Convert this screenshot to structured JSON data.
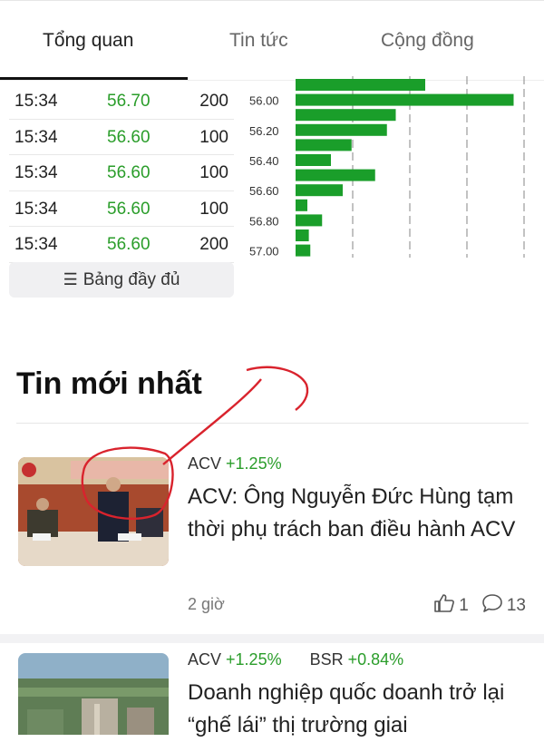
{
  "tabs": [
    {
      "label": "Tổng quan"
    },
    {
      "label": "Tin tức"
    },
    {
      "label": "Cộng đồng"
    }
  ],
  "trades": [
    {
      "time": "15:34",
      "price": "56.70",
      "volume": "200"
    },
    {
      "time": "15:34",
      "price": "56.60",
      "volume": "100"
    },
    {
      "time": "15:34",
      "price": "56.60",
      "volume": "100"
    },
    {
      "time": "15:34",
      "price": "56.60",
      "volume": "100"
    },
    {
      "time": "15:34",
      "price": "56.60",
      "volume": "200"
    }
  ],
  "full_table_label": "Bảng đầy đủ",
  "chart_data": {
    "type": "bar",
    "orientation": "horizontal",
    "categories": [
      "",
      "56.00",
      "",
      "56.20",
      "",
      "56.40",
      "",
      "56.60",
      "",
      "56.80",
      "",
      "57.00"
    ],
    "values": [
      88,
      148,
      68,
      62,
      38,
      24,
      54,
      32,
      8,
      18,
      9,
      10
    ],
    "bar_color": "#1a9e2a"
  },
  "section_title": "Tin mới nhất",
  "news": [
    {
      "tickers": [
        {
          "symbol": "ACV",
          "change": "+1.25%"
        }
      ],
      "title": "ACV: Ông Nguyễn Đức Hùng tạm thời phụ trách ban điều hành ACV",
      "time": "2 giờ",
      "likes": "1",
      "comments": "13"
    },
    {
      "tickers": [
        {
          "symbol": "ACV",
          "change": "+1.25%"
        },
        {
          "symbol": "BSR",
          "change": "+0.84%"
        }
      ],
      "title": "Doanh nghiệp quốc doanh trở lại “ghế lái” thị trường giai"
    }
  ],
  "colors": {
    "up": "#2a9d2a",
    "annotation": "#d9232d"
  }
}
